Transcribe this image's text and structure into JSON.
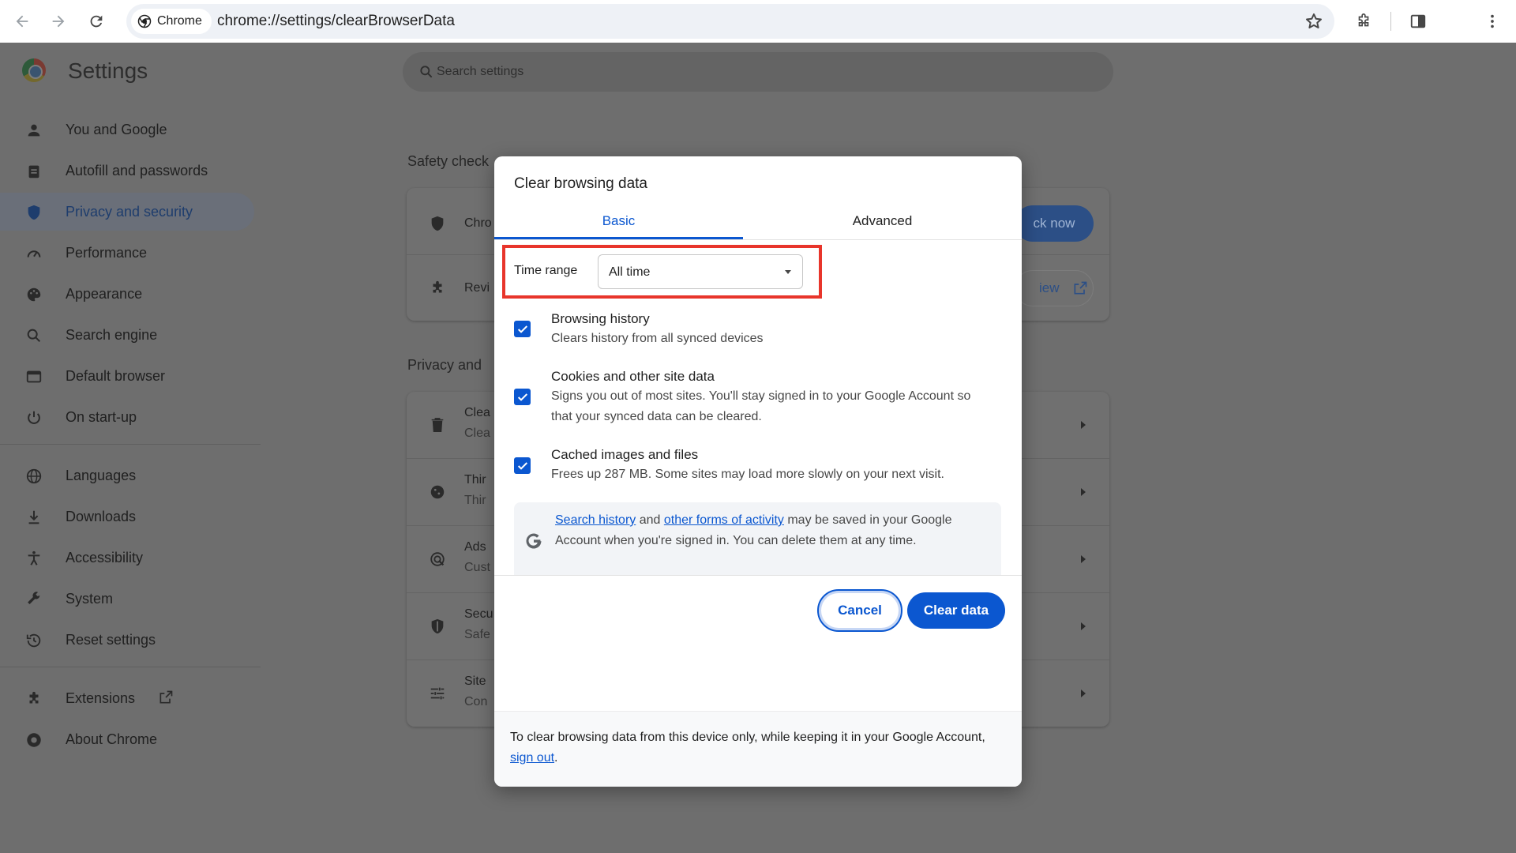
{
  "browser": {
    "chip_label": "Chrome",
    "url": "chrome://settings/clearBrowserData"
  },
  "settings": {
    "title": "Settings",
    "search_placeholder": "Search settings",
    "sidebar": [
      {
        "label": "You and Google",
        "icon": "person-icon"
      },
      {
        "label": "Autofill and passwords",
        "icon": "clipboard-icon"
      },
      {
        "label": "Privacy and security",
        "icon": "shield-icon",
        "active": true
      },
      {
        "label": "Performance",
        "icon": "speedometer-icon"
      },
      {
        "label": "Appearance",
        "icon": "palette-icon"
      },
      {
        "label": "Search engine",
        "icon": "search-icon"
      },
      {
        "label": "Default browser",
        "icon": "browser-icon"
      },
      {
        "label": "On start-up",
        "icon": "power-icon"
      },
      {
        "label": "Languages",
        "icon": "globe-icon"
      },
      {
        "label": "Downloads",
        "icon": "download-icon"
      },
      {
        "label": "Accessibility",
        "icon": "accessibility-icon"
      },
      {
        "label": "System",
        "icon": "wrench-icon"
      },
      {
        "label": "Reset settings",
        "icon": "history-icon"
      },
      {
        "label": "Extensions",
        "icon": "puzzle-icon"
      },
      {
        "label": "About Chrome",
        "icon": "chrome-icon"
      }
    ],
    "safety_heading": "Safety check",
    "safety_rows": [
      {
        "title": "Chro"
      },
      {
        "title": "Revi"
      }
    ],
    "check_now_label": "ck now",
    "review_label": "iew",
    "privacy_heading": "Privacy and",
    "privacy_rows": [
      {
        "title": "Clea",
        "sub": "Clea"
      },
      {
        "title": "Thir",
        "sub": "Thir"
      },
      {
        "title": "Ads",
        "sub": "Cust"
      },
      {
        "title": "Secu",
        "sub": "Safe"
      },
      {
        "title": "Site",
        "sub": "Con"
      }
    ]
  },
  "dialog": {
    "title": "Clear browsing data",
    "tabs": {
      "basic": "Basic",
      "advanced": "Advanced"
    },
    "time_range_label": "Time range",
    "time_range_value": "All time",
    "options": [
      {
        "title": "Browsing history",
        "sub": "Clears history from all synced devices",
        "checked": true
      },
      {
        "title": "Cookies and other site data",
        "sub": "Signs you out of most sites. You'll stay signed in to your Google Account so that your synced data can be cleared.",
        "checked": true
      },
      {
        "title": "Cached images and files",
        "sub": "Frees up 287 MB. Some sites may load more slowly on your next visit.",
        "checked": true
      }
    ],
    "info": {
      "link1": "Search history",
      "and": " and ",
      "link2": "other forms of activity",
      "rest": " may be saved in your Google Account when you're signed in. You can delete them at any time."
    },
    "cancel_label": "Cancel",
    "clear_label": "Clear data",
    "footer": {
      "text": "To clear browsing data from this device only, while keeping it in your Google Account, ",
      "link": "sign out",
      "end": "."
    }
  },
  "colors": {
    "accent": "#0b57d0",
    "highlight": "#e8352b",
    "overlay": "#6e6e6e"
  }
}
